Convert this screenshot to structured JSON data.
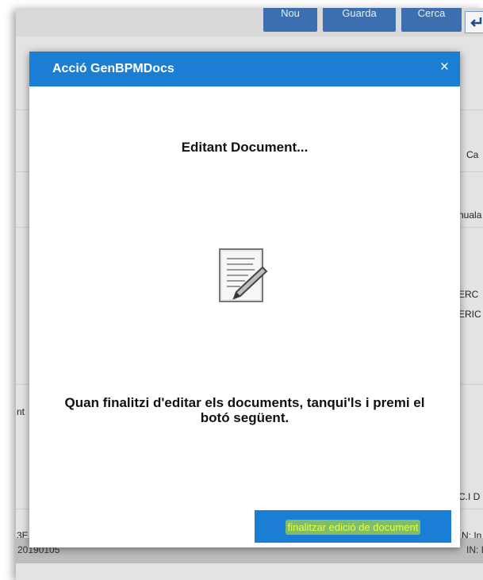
{
  "toolbar": {
    "new_label": "Nou",
    "save_label": "Guarda",
    "search_label": "Cerca"
  },
  "background": {
    "fragments": [
      "Ca",
      "nuala",
      "ERC",
      "ERIC",
      "nt",
      "C.I D",
      "3E",
      "N: In"
    ],
    "status_left": "20190105",
    "status_right": "IN: In"
  },
  "modal": {
    "title": "Acció GenBPMDocs",
    "close_symbol": "×",
    "heading": "Editant Document...",
    "icon": "document-edit-icon",
    "instructions": "Quan finalitzi d'editar els documents, tanqui'ls i premi el botó següent.",
    "finish_button": "finalitzar edició de document"
  },
  "colors": {
    "modal_header": "#1a7fd4",
    "toolbar_button": "#3c6fb0",
    "finish_text": "#e8ff3a"
  }
}
